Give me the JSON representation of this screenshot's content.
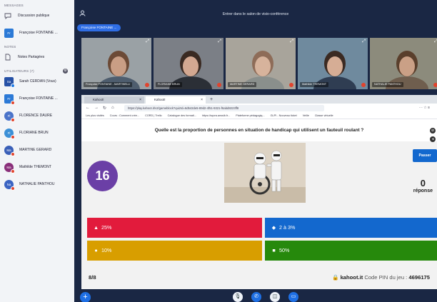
{
  "sidebar": {
    "messages_title": "MESSAGES",
    "messages": [
      {
        "label": "Discussion publique",
        "icon": "chat-bubble-icon"
      },
      {
        "label": "Françoise FONTAINE ...",
        "avatar": "Fr",
        "color": "#2b79d6"
      }
    ],
    "notes_title": "NOTES",
    "notes": [
      {
        "label": "Notes Partagées",
        "icon": "document-icon"
      }
    ],
    "users_title": "UTILISATEURS (7)",
    "users": [
      {
        "avatar": "Sa",
        "name": "Sarah CERDAN (Vous)",
        "color": "#2651a6",
        "square": true,
        "status": "blue"
      },
      {
        "avatar": "Fr",
        "name": "Françoise FONTAINE ...",
        "color": "#2b79d6",
        "square": true,
        "status": "red"
      },
      {
        "avatar": "Fl",
        "name": "FLORENCE DAURE",
        "color": "#4a73c9",
        "square": false,
        "status": "red"
      },
      {
        "avatar": "Fl",
        "name": "FLORIANE BRUN",
        "color": "#3b8fd6",
        "square": false,
        "status": "red"
      },
      {
        "avatar": "Ma",
        "name": "MARTINE GERARD",
        "color": "#3a5fb8",
        "square": false,
        "status": "red"
      },
      {
        "avatar": "Ma",
        "name": "Mathilde THEMONT",
        "color": "#8a2f7a",
        "square": false,
        "status": "red"
      },
      {
        "avatar": "Na",
        "name": "NATHALIE PANTHOU",
        "color": "#3a63c2",
        "square": false,
        "status": "red"
      }
    ]
  },
  "header": {
    "room_title": "Entrer dans le salon de visio-conférence",
    "presenter_chip": "Françoise FONTAINE ..."
  },
  "videos": [
    {
      "name": "Françoise FONTAINE - MARTINELLI",
      "bg": "#9aa1a5",
      "skin": "#c99e85",
      "hair": "#6c4a36",
      "shirt": "#4e5d6e"
    },
    {
      "name": "FLORIANE BRUN",
      "bg": "#7b7f86",
      "skin": "#d3a891",
      "hair": "#3a2a22",
      "shirt": "#2b2f36"
    },
    {
      "name": "MARTINE GERARD",
      "bg": "#a8a49b",
      "skin": "#d7b39c",
      "hair": "#8e6c58",
      "shirt": "#8a8f8c"
    },
    {
      "name": "Mathilde THEMONT",
      "bg": "#6f8a9e",
      "skin": "#d6ad95",
      "hair": "#3b2a22",
      "shirt": "#2f3d52"
    },
    {
      "name": "NATHALIE PANTHOU",
      "bg": "#8c8b7c",
      "skin": "#caa086",
      "hair": "#5a3f2c",
      "shirt": "#6f5e4e"
    }
  ],
  "browser": {
    "tabs": [
      {
        "label": "Kahoot!"
      },
      {
        "label": "Kahoot!"
      }
    ],
    "url": "https://play.kahoot.it/v2/gameblock?quizId=6d542de5-89d2-4f51-9321-f6abd8223ff8",
    "bookmarks": [
      "Les plus visités",
      "Cours : Comment crée...",
      "CORD | Trello",
      "Catalogue des formati...",
      "https://sqora.anssib.fr...",
      "Plateforme pédagogiq...",
      "GLPI - Nouveau ticket",
      "Veille",
      "Classe virtuelle"
    ]
  },
  "kahoot": {
    "question": "Quelle est la proportion de personnes en situation de handicap qui utilisent un fauteuil roulant ?",
    "timer": "16",
    "skip_label": "Passer",
    "answers_count": "0",
    "answers_label": "réponse",
    "answers": [
      {
        "shape": "▲",
        "text": "25%"
      },
      {
        "shape": "◆",
        "text": "2 à 3%"
      },
      {
        "shape": "●",
        "text": "10%"
      },
      {
        "shape": "■",
        "text": "50%"
      }
    ],
    "question_count": "8/8",
    "host": "kahoot.it",
    "pin_label": "Code PIN du jeu :",
    "pin": "4696175"
  }
}
